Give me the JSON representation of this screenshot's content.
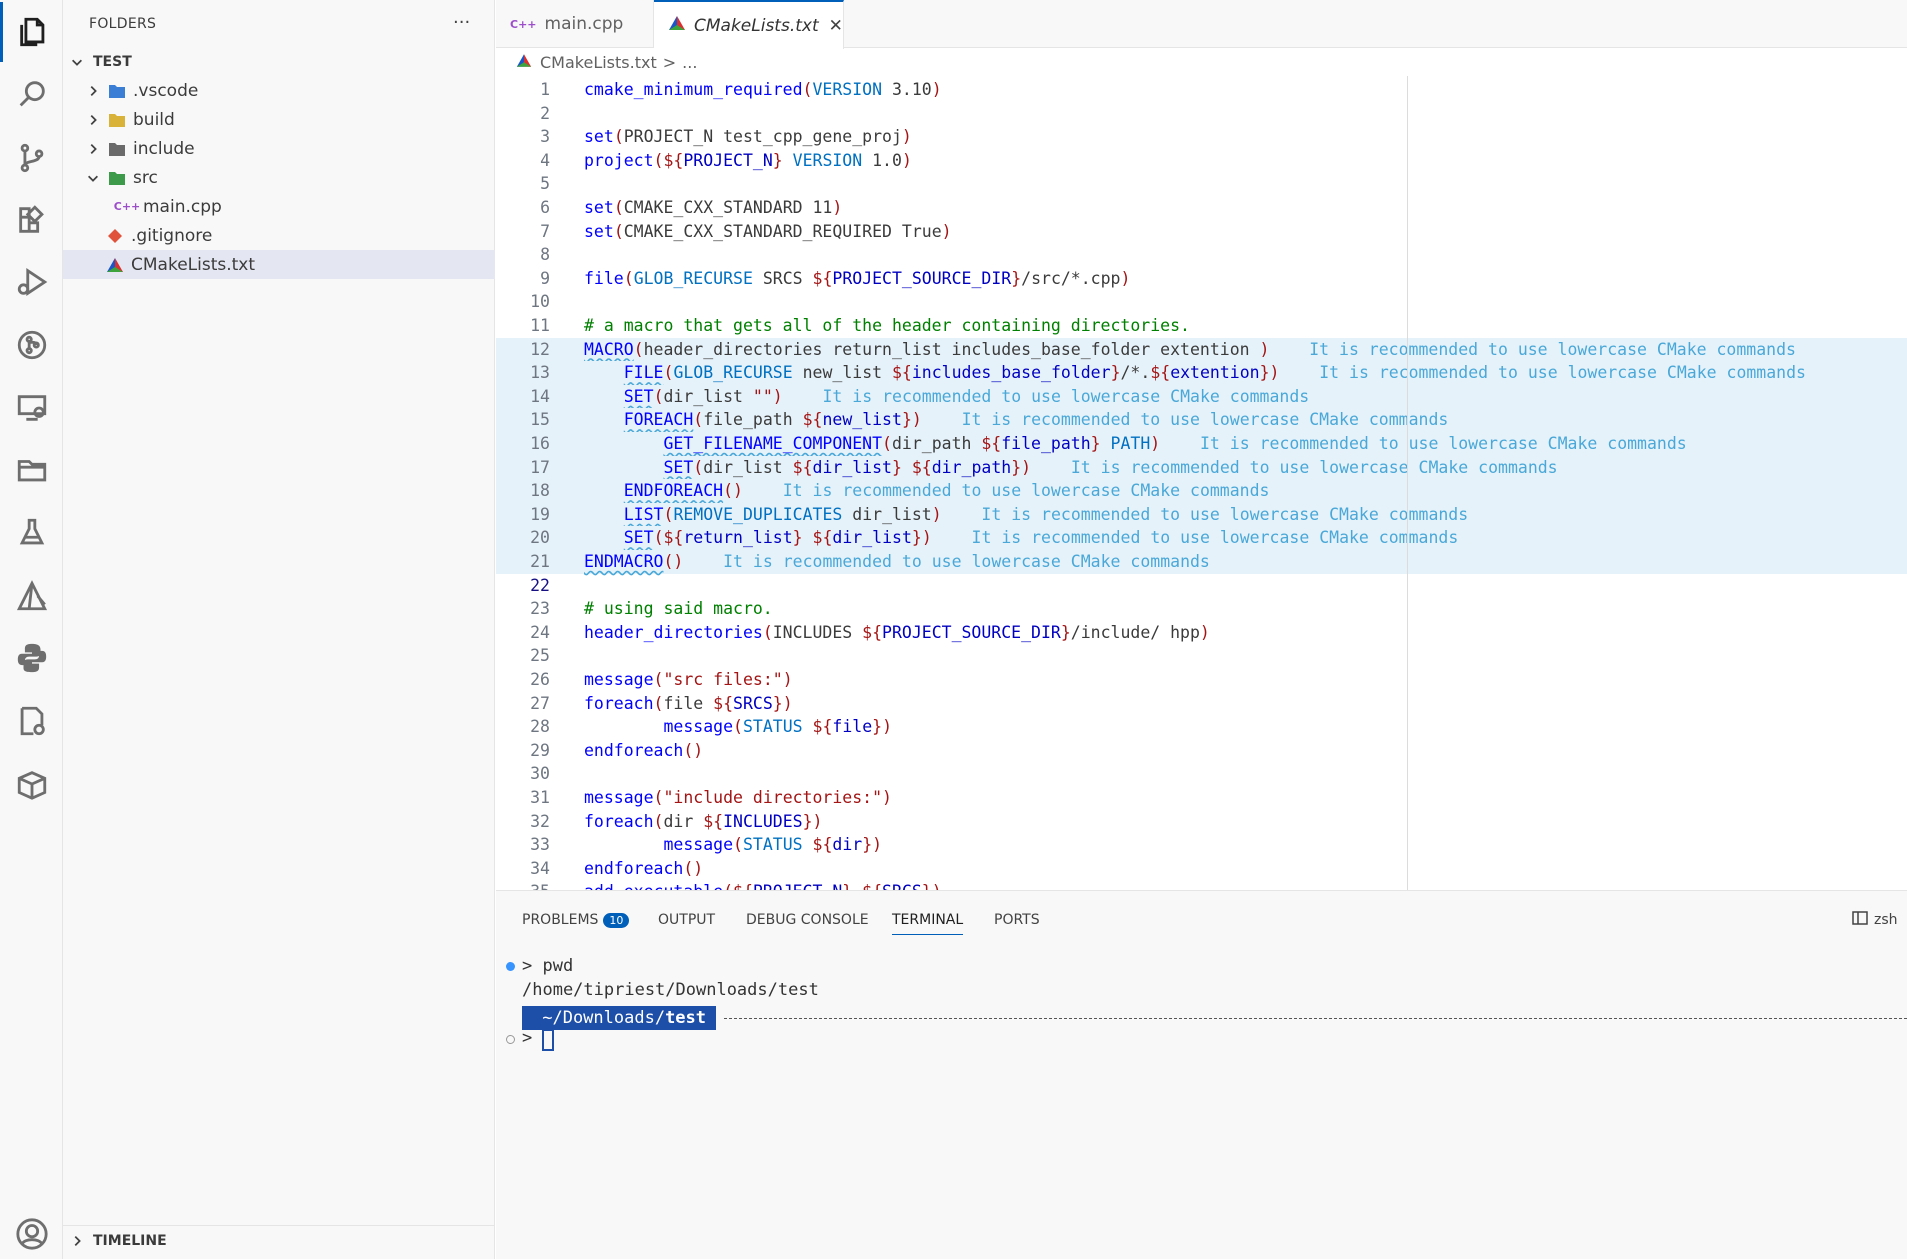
{
  "sidebar": {
    "title": "FOLDERS",
    "more": "···",
    "root": "TEST",
    "items": [
      {
        "label": ".vscode",
        "type": "folder",
        "color": "#3b7ed6"
      },
      {
        "label": "build",
        "type": "folder",
        "color": "#d9b23a"
      },
      {
        "label": "include",
        "type": "folder",
        "color": "#6a6a6a"
      },
      {
        "label": "src",
        "type": "folder-open",
        "color": "#3d9a4a"
      },
      {
        "label": "main.cpp",
        "type": "cpp"
      },
      {
        "label": ".gitignore",
        "type": "git"
      },
      {
        "label": "CMakeLists.txt",
        "type": "cmake"
      }
    ],
    "timeline": "TIMELINE"
  },
  "tabs": [
    {
      "label": "main.cpp",
      "icon": "C++"
    },
    {
      "label": "CMakeLists.txt",
      "icon": "cmake",
      "close": "✕"
    }
  ],
  "breadcrumb": {
    "file": "CMakeLists.txt",
    "sep": ">",
    "more": "..."
  },
  "code_lines": [
    "cmake_minimum_required(VERSION 3.10)",
    "",
    "set(PROJECT_N test_cpp_gene_proj)",
    "project(${PROJECT_N} VERSION 1.0)",
    "",
    "set(CMAKE_CXX_STANDARD 11)",
    "set(CMAKE_CXX_STANDARD_REQUIRED True)",
    "",
    "file(GLOB_RECURSE SRCS ${PROJECT_SOURCE_DIR}/src/*.cpp)",
    "",
    "# a macro that gets all of the header containing directories.",
    "MACRO(header_directories return_list includes_base_folder extention )",
    "    FILE(GLOB_RECURSE new_list ${includes_base_folder}/*.${extention})",
    "    SET(dir_list \"\")",
    "    FOREACH(file_path ${new_list})",
    "        GET_FILENAME_COMPONENT(dir_path ${file_path} PATH)",
    "        SET(dir_list ${dir_list} ${dir_path})",
    "    ENDFOREACH()",
    "    LIST(REMOVE_DUPLICATES dir_list)",
    "    SET(${return_list} ${dir_list})",
    "ENDMACRO()",
    "",
    "# using said macro.",
    "header_directories(INCLUDES ${PROJECT_SOURCE_DIR}/include/ hpp)",
    "",
    "message(\"src files:\")",
    "foreach(file ${SRCS})",
    "        message(STATUS ${file})",
    "endforeach()",
    "",
    "message(\"include directories:\")",
    "foreach(dir ${INCLUDES})",
    "        message(STATUS ${dir})",
    "endforeach()",
    "add_executable(${PROJECT_N} ${SRCS})"
  ],
  "warning_text": "It is recommended to use lowercase CMake commands",
  "panel": {
    "tabs": [
      "PROBLEMS",
      "OUTPUT",
      "DEBUG CONSOLE",
      "TERMINAL",
      "PORTS"
    ],
    "problems_count": "10",
    "shell": "zsh",
    "terminal": {
      "cmd_line": "> pwd",
      "output": "/home/tipriest/Downloads/test",
      "prompt_path": " ~/Downloads/",
      "prompt_dir": "test",
      "prompt_line": "> "
    }
  },
  "colors": {
    "accent": "#005fb8",
    "selection": "#e4e6f1",
    "macro_highlight": "#e6f2fa"
  }
}
